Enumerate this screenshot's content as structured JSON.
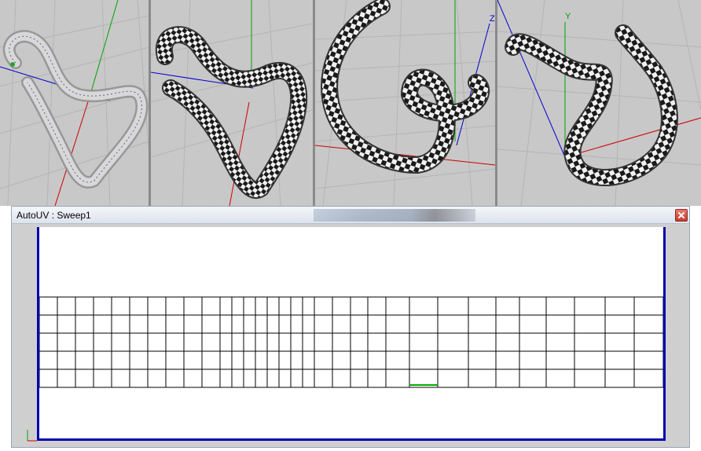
{
  "window": {
    "title": "AutoUV : Sweep1"
  },
  "viewports": [
    {
      "name": "wireframe-view",
      "axis_labels": []
    },
    {
      "name": "checker-view-2",
      "axis_labels": []
    },
    {
      "name": "checker-view-3",
      "axis_labels": [
        "Z"
      ]
    },
    {
      "name": "checker-view-4",
      "axis_labels": [
        "Y"
      ]
    }
  ],
  "uv_grid": {
    "rows": 5,
    "columns": 33
  },
  "colors": {
    "viewport_bg": "#c8c8c8",
    "x_axis": "#cc0000",
    "y_axis": "#00a000",
    "z_axis": "#0000cc",
    "uv_border": "#0000b0",
    "grid_line": "#000000",
    "selected_edge": "#00aa00"
  }
}
